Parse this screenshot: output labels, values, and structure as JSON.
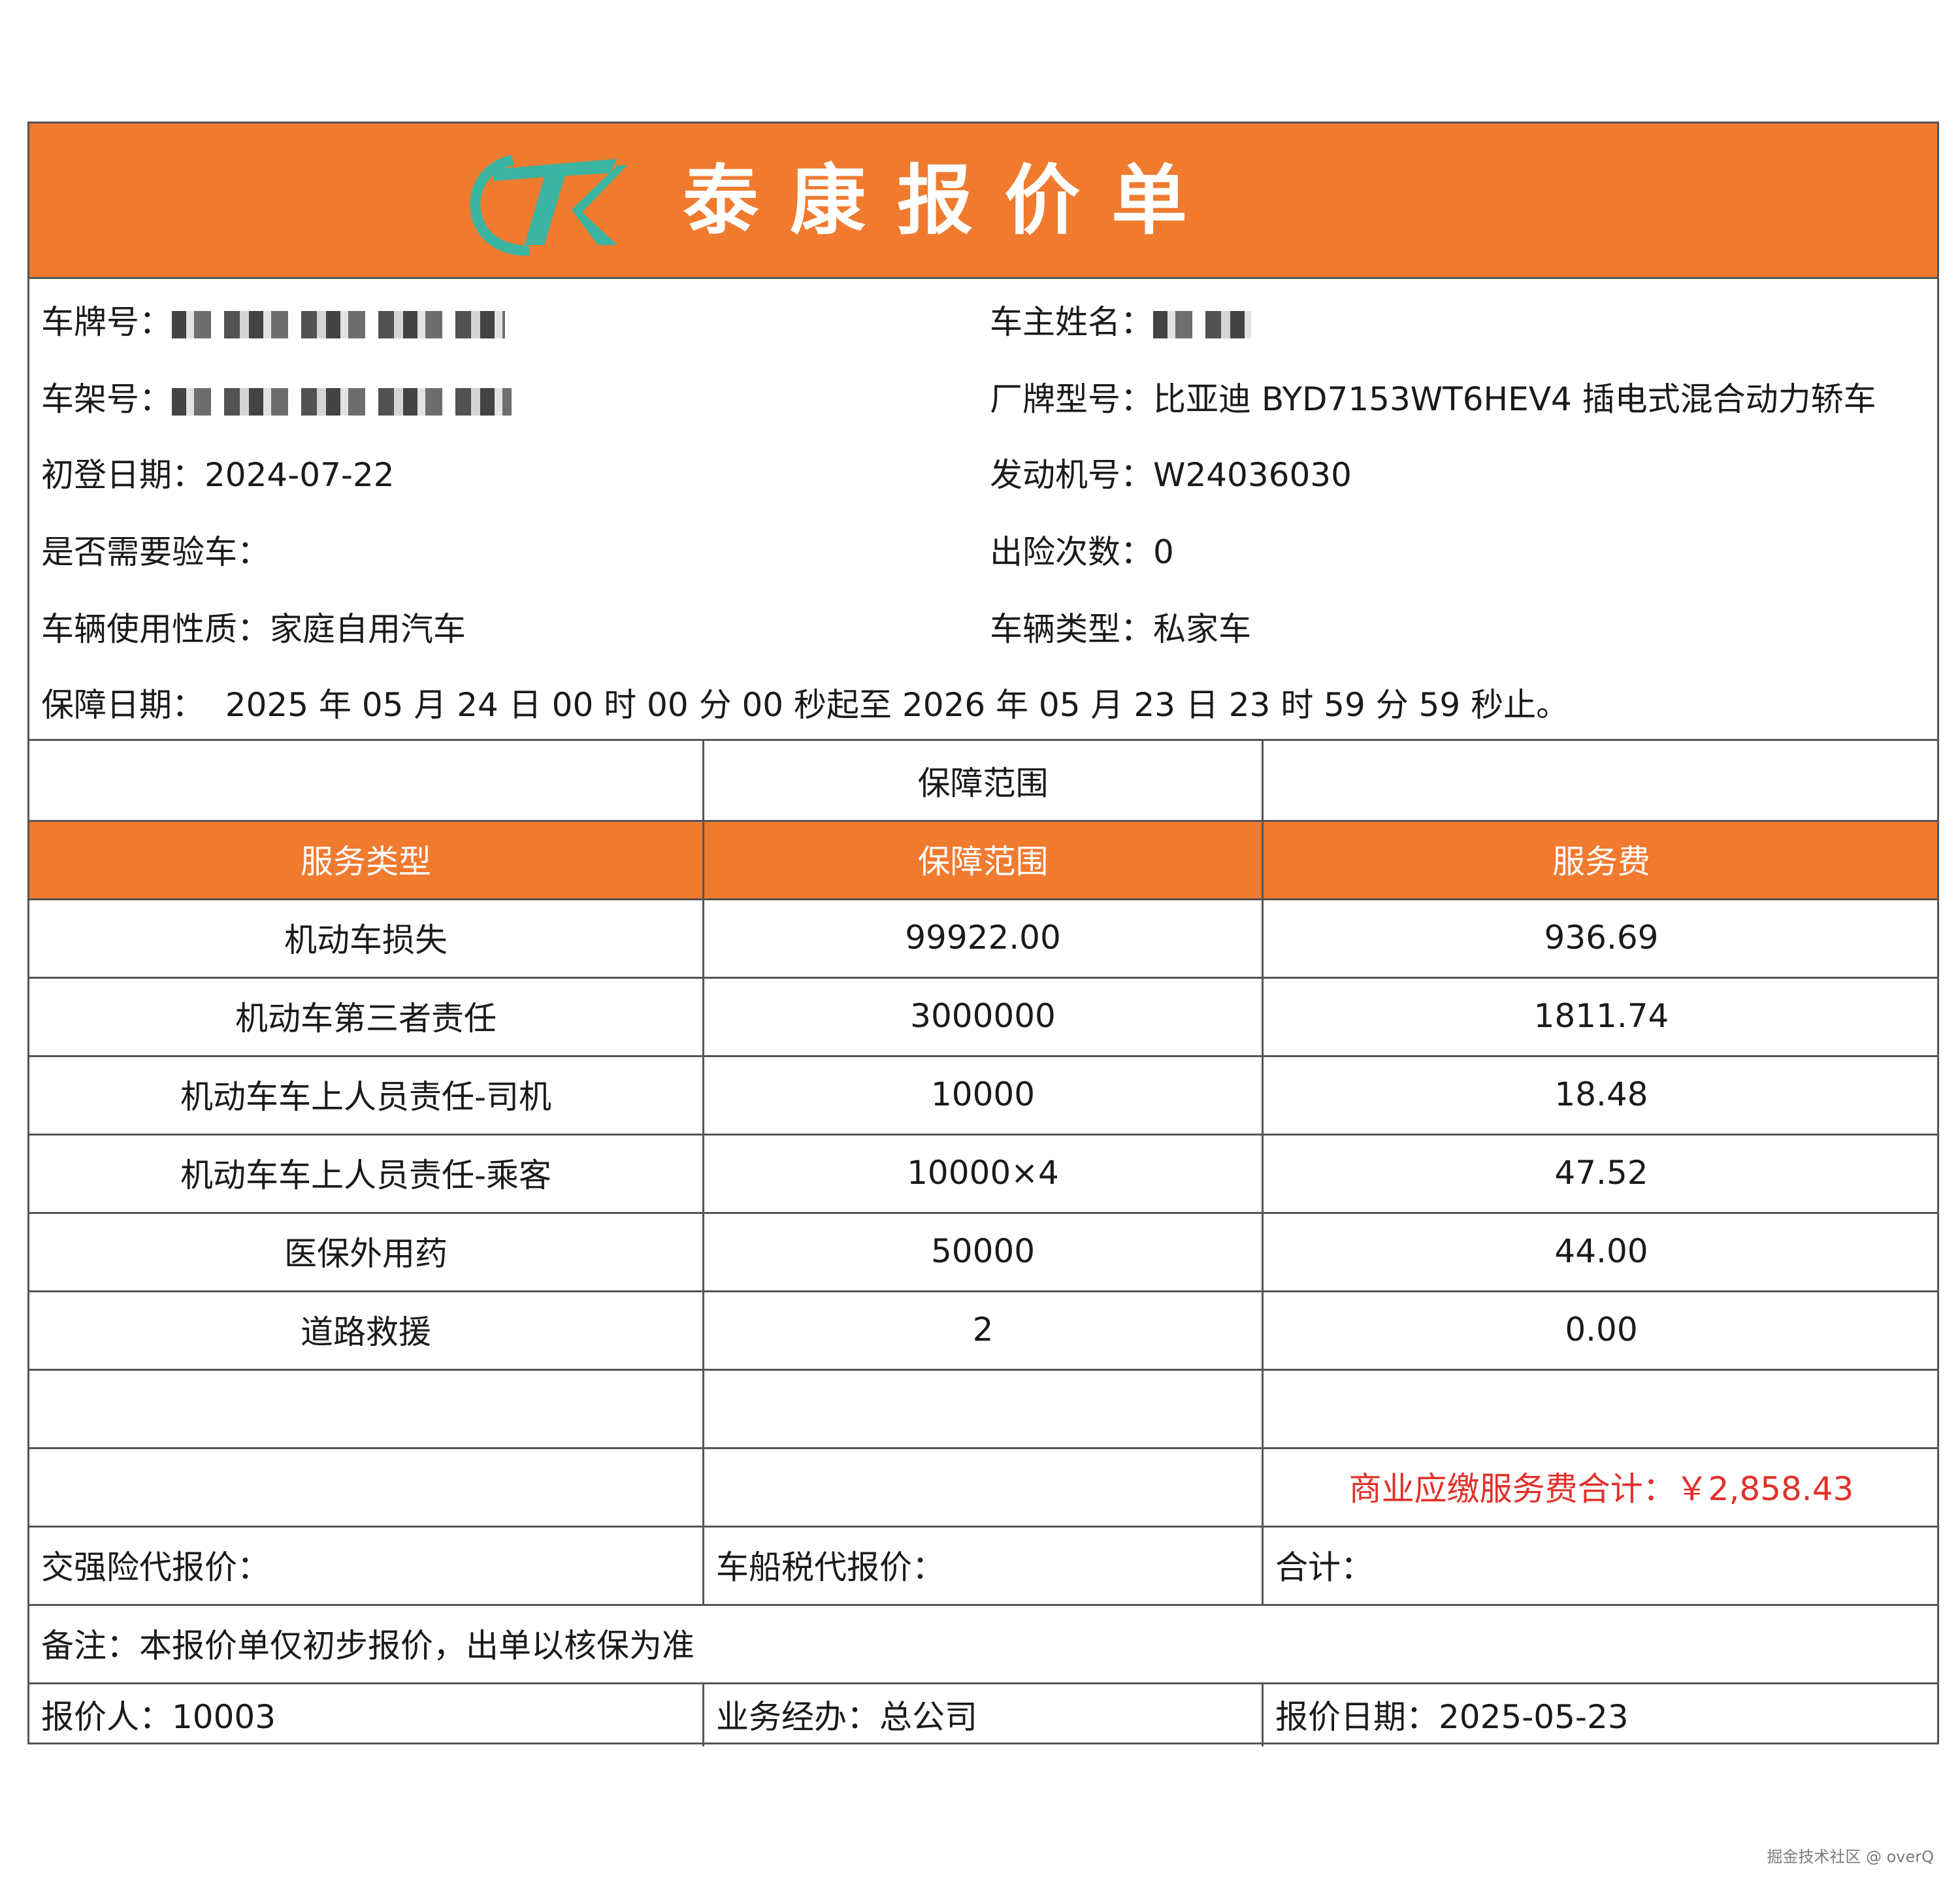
{
  "header": {
    "logo_text": "TK",
    "title": "泰康报价单",
    "brand_color": "#f07a2e",
    "logo_color": "#3bb5a2"
  },
  "vehicle": {
    "plate_label": "车牌号：",
    "owner_label": "车主姓名：",
    "vin_label": "车架号：",
    "model_label": "厂牌型号：",
    "model_value": "比亚迪 BYD7153WT6HEV4 插电式混合动力轿车",
    "first_reg_label": "初登日期：",
    "first_reg_value": "2024-07-22",
    "engine_label": "发动机号：",
    "engine_value": "W24036030",
    "inspection_label": "是否需要验车：",
    "claims_label": "出险次数：",
    "claims_value": "0",
    "usage_label": "车辆使用性质：",
    "usage_value": "家庭自用汽车",
    "type_label": "车辆类型：",
    "type_value": "私家车",
    "period_label": "保障日期：",
    "period_value": "2025 年 05 月 24 日 00 时 00 分 00 秒起至 2026 年 05 月 23 日 23 时 59 分 59 秒止。"
  },
  "table": {
    "section_title": "保障范围",
    "headers": [
      "服务类型",
      "保障范围",
      "服务费"
    ],
    "rows": [
      [
        "机动车损失",
        "99922.00",
        "936.69"
      ],
      [
        "机动车第三者责任",
        "3000000",
        "1811.74"
      ],
      [
        "机动车车上人员责任-司机",
        "10000",
        "18.48"
      ],
      [
        "机动车车上人员责任-乘客",
        "10000×4",
        "47.52"
      ],
      [
        "医保外用药",
        "50000",
        "44.00"
      ],
      [
        "道路救援",
        "2",
        "0.00"
      ]
    ],
    "total_text": "商业应缴服务费合计：￥2,858.43",
    "total_color": "#e0312a"
  },
  "footer": {
    "compulsory_label": "交强险代报价：",
    "vessel_tax_label": "车船税代报价：",
    "sum_label": "合计：",
    "remark": "备注：本报价单仅初步报价，出单以核保为准",
    "quoter": "报价人：10003",
    "agent": "业务经办：总公司",
    "quote_date": "报价日期：2025-05-23"
  },
  "watermark": "掘金技术社区 @ overQ"
}
